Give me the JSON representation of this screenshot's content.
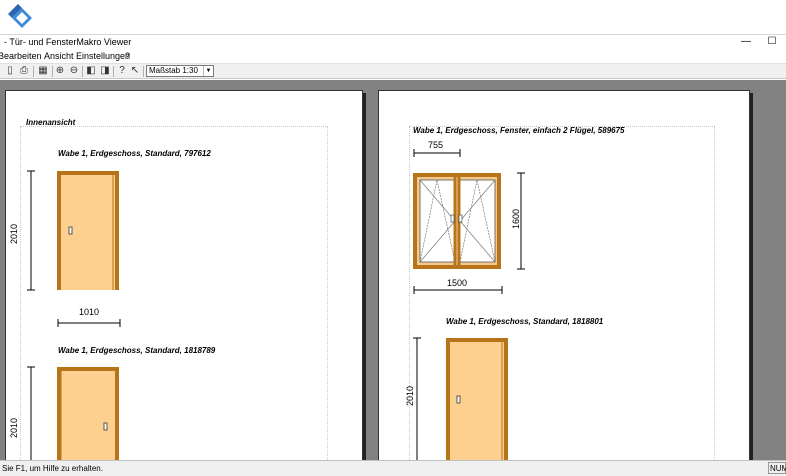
{
  "window": {
    "title": "- Tür- und FensterMakro Viewer",
    "minimize": "—",
    "maximize": "☐"
  },
  "menu": {
    "items": [
      "Bearbeiten",
      "Ansicht",
      "Einstellungen",
      "?"
    ]
  },
  "toolbar": {
    "scale_value": "Maßstab 1:30"
  },
  "page_left": {
    "section_title": "Innenansicht",
    "items": [
      {
        "label": "Wabe 1, Erdgeschoss, Standard, 797612",
        "height": "2010",
        "width": "1010"
      },
      {
        "label": "Wabe 1, Erdgeschoss, Standard, 1818789",
        "height": "2010"
      }
    ]
  },
  "page_right": {
    "window_item": {
      "label": "Wabe 1, Erdgeschoss, Fenster, einfach 2 Flügel, 589675",
      "sash_width": "755",
      "height": "1600",
      "width": "1500"
    },
    "door_item": {
      "label": "Wabe 1, Erdgeschoss, Standard, 1818801",
      "height": "2010"
    }
  },
  "statusbar": {
    "text": "Sie F1, um Hilfe zu erhalten.",
    "num": "NUM"
  },
  "colors": {
    "door_fill": "#fdd08f",
    "frame": "#b8741a",
    "workspace": "#828282"
  }
}
